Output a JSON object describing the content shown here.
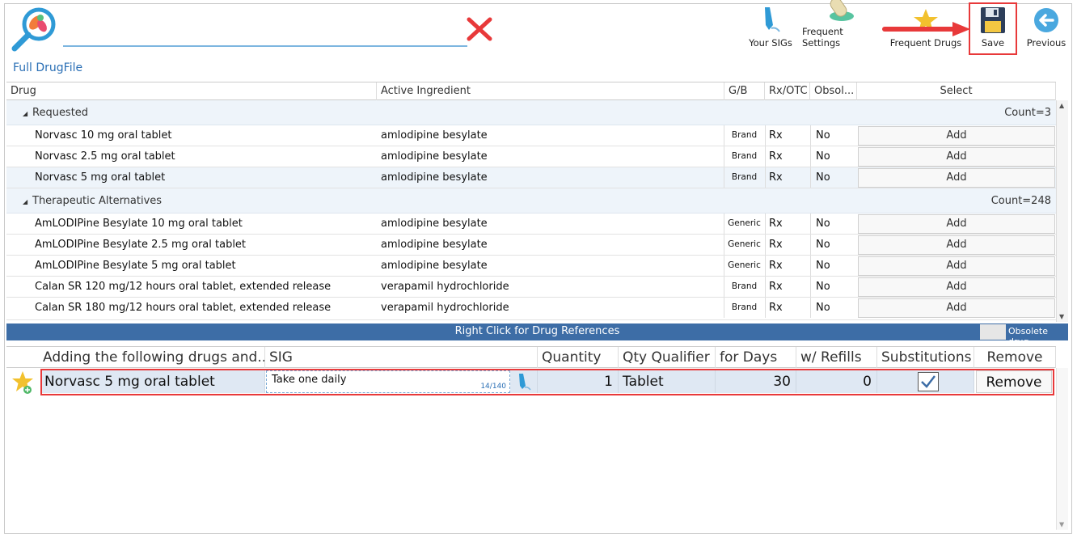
{
  "toolbar": {
    "buttons": [
      {
        "label": "Your SIGs",
        "icon": "pen-icon"
      },
      {
        "label": "Frequent Settings",
        "icon": "pill-settings-icon"
      },
      {
        "label": "Frequent Drugs",
        "icon": "star-icon"
      },
      {
        "label": "Save",
        "icon": "floppy-disk-icon"
      },
      {
        "label": "Previous",
        "icon": "back-arrow-icon"
      }
    ]
  },
  "drugfile": {
    "title": "Full DrugFile",
    "columns": [
      "Drug",
      "Active Ingredient",
      "G/B",
      "Rx/OTC",
      "Obsol...",
      "Select"
    ],
    "groups": [
      {
        "name": "Requested",
        "count": "Count=3",
        "rows": [
          {
            "drug": "Norvasc 10 mg oral tablet",
            "ingredient": "amlodipine besylate",
            "gb": "Brand",
            "rx": "Rx",
            "obsolete": "No",
            "action": "Add"
          },
          {
            "drug": "Norvasc 2.5 mg oral tablet",
            "ingredient": "amlodipine besylate",
            "gb": "Brand",
            "rx": "Rx",
            "obsolete": "No",
            "action": "Add"
          },
          {
            "drug": "Norvasc 5 mg oral tablet",
            "ingredient": "amlodipine besylate",
            "gb": "Brand",
            "rx": "Rx",
            "obsolete": "No",
            "action": "Add"
          }
        ]
      },
      {
        "name": "Therapeutic Alternatives",
        "count": "Count=248",
        "rows": [
          {
            "drug": "AmLODIPine Besylate 10 mg oral tablet",
            "ingredient": "amlodipine besylate",
            "gb": "Generic",
            "rx": "Rx",
            "obsolete": "No",
            "action": "Add"
          },
          {
            "drug": "AmLODIPine Besylate 2.5 mg oral tablet",
            "ingredient": "amlodipine besylate",
            "gb": "Generic",
            "rx": "Rx",
            "obsolete": "No",
            "action": "Add"
          },
          {
            "drug": "AmLODIPine Besylate 5 mg oral tablet",
            "ingredient": "amlodipine besylate",
            "gb": "Generic",
            "rx": "Rx",
            "obsolete": "No",
            "action": "Add"
          },
          {
            "drug": "Calan SR 120 mg/12 hours oral tablet, extended release",
            "ingredient": "verapamil hydrochloride",
            "gb": "Brand",
            "rx": "Rx",
            "obsolete": "No",
            "action": "Add"
          },
          {
            "drug": "Calan SR 180 mg/12 hours oral tablet, extended release",
            "ingredient": "verapamil hydrochloride",
            "gb": "Brand",
            "rx": "Rx",
            "obsolete": "No",
            "action": "Add"
          }
        ]
      }
    ]
  },
  "status_bar": {
    "text": "Right Click for Drug References",
    "legend": "Obsolete drug"
  },
  "adding": {
    "columns": [
      "Adding the following drugs and...",
      "SIG",
      "Quantity",
      "Qty Qualifier",
      "for Days",
      "w/ Refills",
      "Substitutions",
      "Remove"
    ],
    "row": {
      "drug": "Norvasc 5 mg oral tablet",
      "sig": "Take one daily",
      "sig_counter": "14/140",
      "quantity": "1",
      "qualifier": "Tablet",
      "days": "30",
      "refills": "0",
      "substitutions_checked": true,
      "remove_label": "Remove"
    }
  },
  "colors": {
    "accent": "#3d6da6",
    "highlight": "#e8393a",
    "title": "#2a6fb5"
  }
}
